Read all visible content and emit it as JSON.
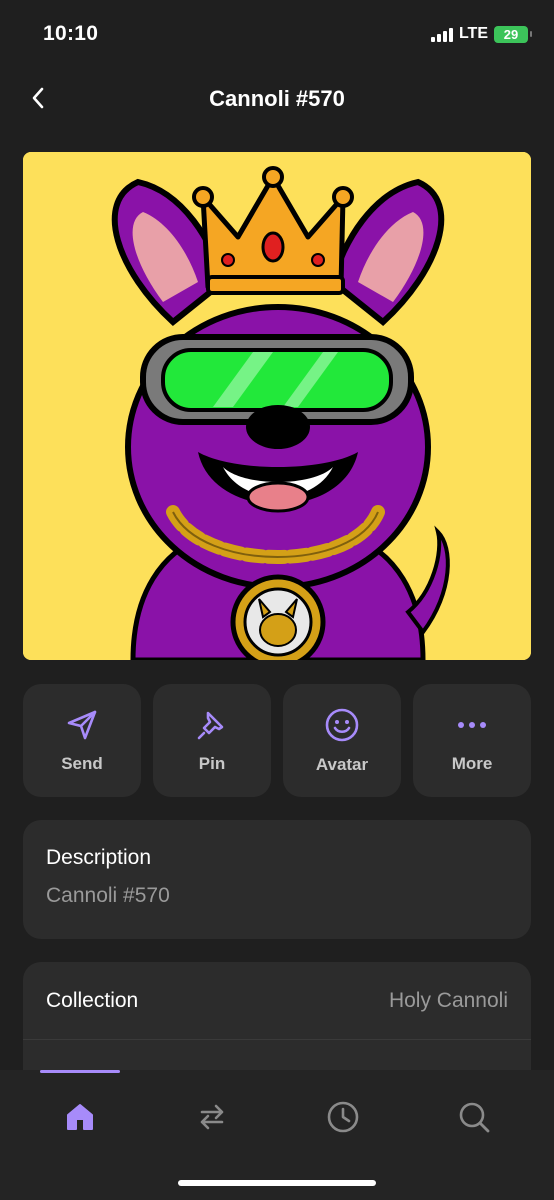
{
  "status_bar": {
    "time": "10:10",
    "network": "LTE",
    "battery": "29"
  },
  "header": {
    "title": "Cannoli #570",
    "back_icon": "chevron-left-icon"
  },
  "nft_image": {
    "background": "#fde05a",
    "alt": "Cannoli #570"
  },
  "actions": [
    {
      "label": "Send",
      "icon": "send-icon"
    },
    {
      "label": "Pin",
      "icon": "pin-icon"
    },
    {
      "label": "Avatar",
      "icon": "smiley-icon"
    },
    {
      "label": "More",
      "icon": "more-icon"
    }
  ],
  "description": {
    "title": "Description",
    "value": "Cannoli #570"
  },
  "collection": {
    "title": "Collection",
    "value": "Holy Cannoli"
  },
  "tab_bar": {
    "active": "home",
    "tabs": [
      {
        "name": "home",
        "icon": "home-icon"
      },
      {
        "name": "swap",
        "icon": "swap-icon"
      },
      {
        "name": "history",
        "icon": "clock-icon"
      },
      {
        "name": "search",
        "icon": "search-icon"
      }
    ]
  },
  "colors": {
    "accent": "#a78bfa",
    "card": "#2c2c2c",
    "background": "#1f1f1f"
  }
}
